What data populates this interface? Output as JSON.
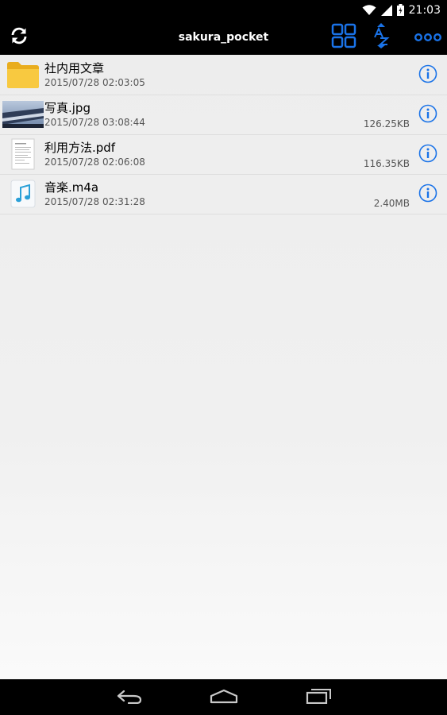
{
  "status_bar": {
    "time": "21:03"
  },
  "toolbar": {
    "title": "sakura_pocket"
  },
  "files": [
    {
      "name": "社内用文章",
      "date": "2015/07/28 02:03:05",
      "size": "",
      "type": "folder-icon"
    },
    {
      "name": "写真.jpg",
      "date": "2015/07/28 03:08:44",
      "size": "126.25KB",
      "type": "image-thumbnail"
    },
    {
      "name": "利用方法.pdf",
      "date": "2015/07/28 02:06:08",
      "size": "116.35KB",
      "type": "pdf-document-icon"
    },
    {
      "name": "音楽.m4a",
      "date": "2015/07/28 02:31:28",
      "size": "2.40MB",
      "type": "music-note-icon"
    }
  ],
  "colors": {
    "accent": "#1a73e8",
    "folder": "#f6c12c",
    "background": "#eeeeee"
  }
}
